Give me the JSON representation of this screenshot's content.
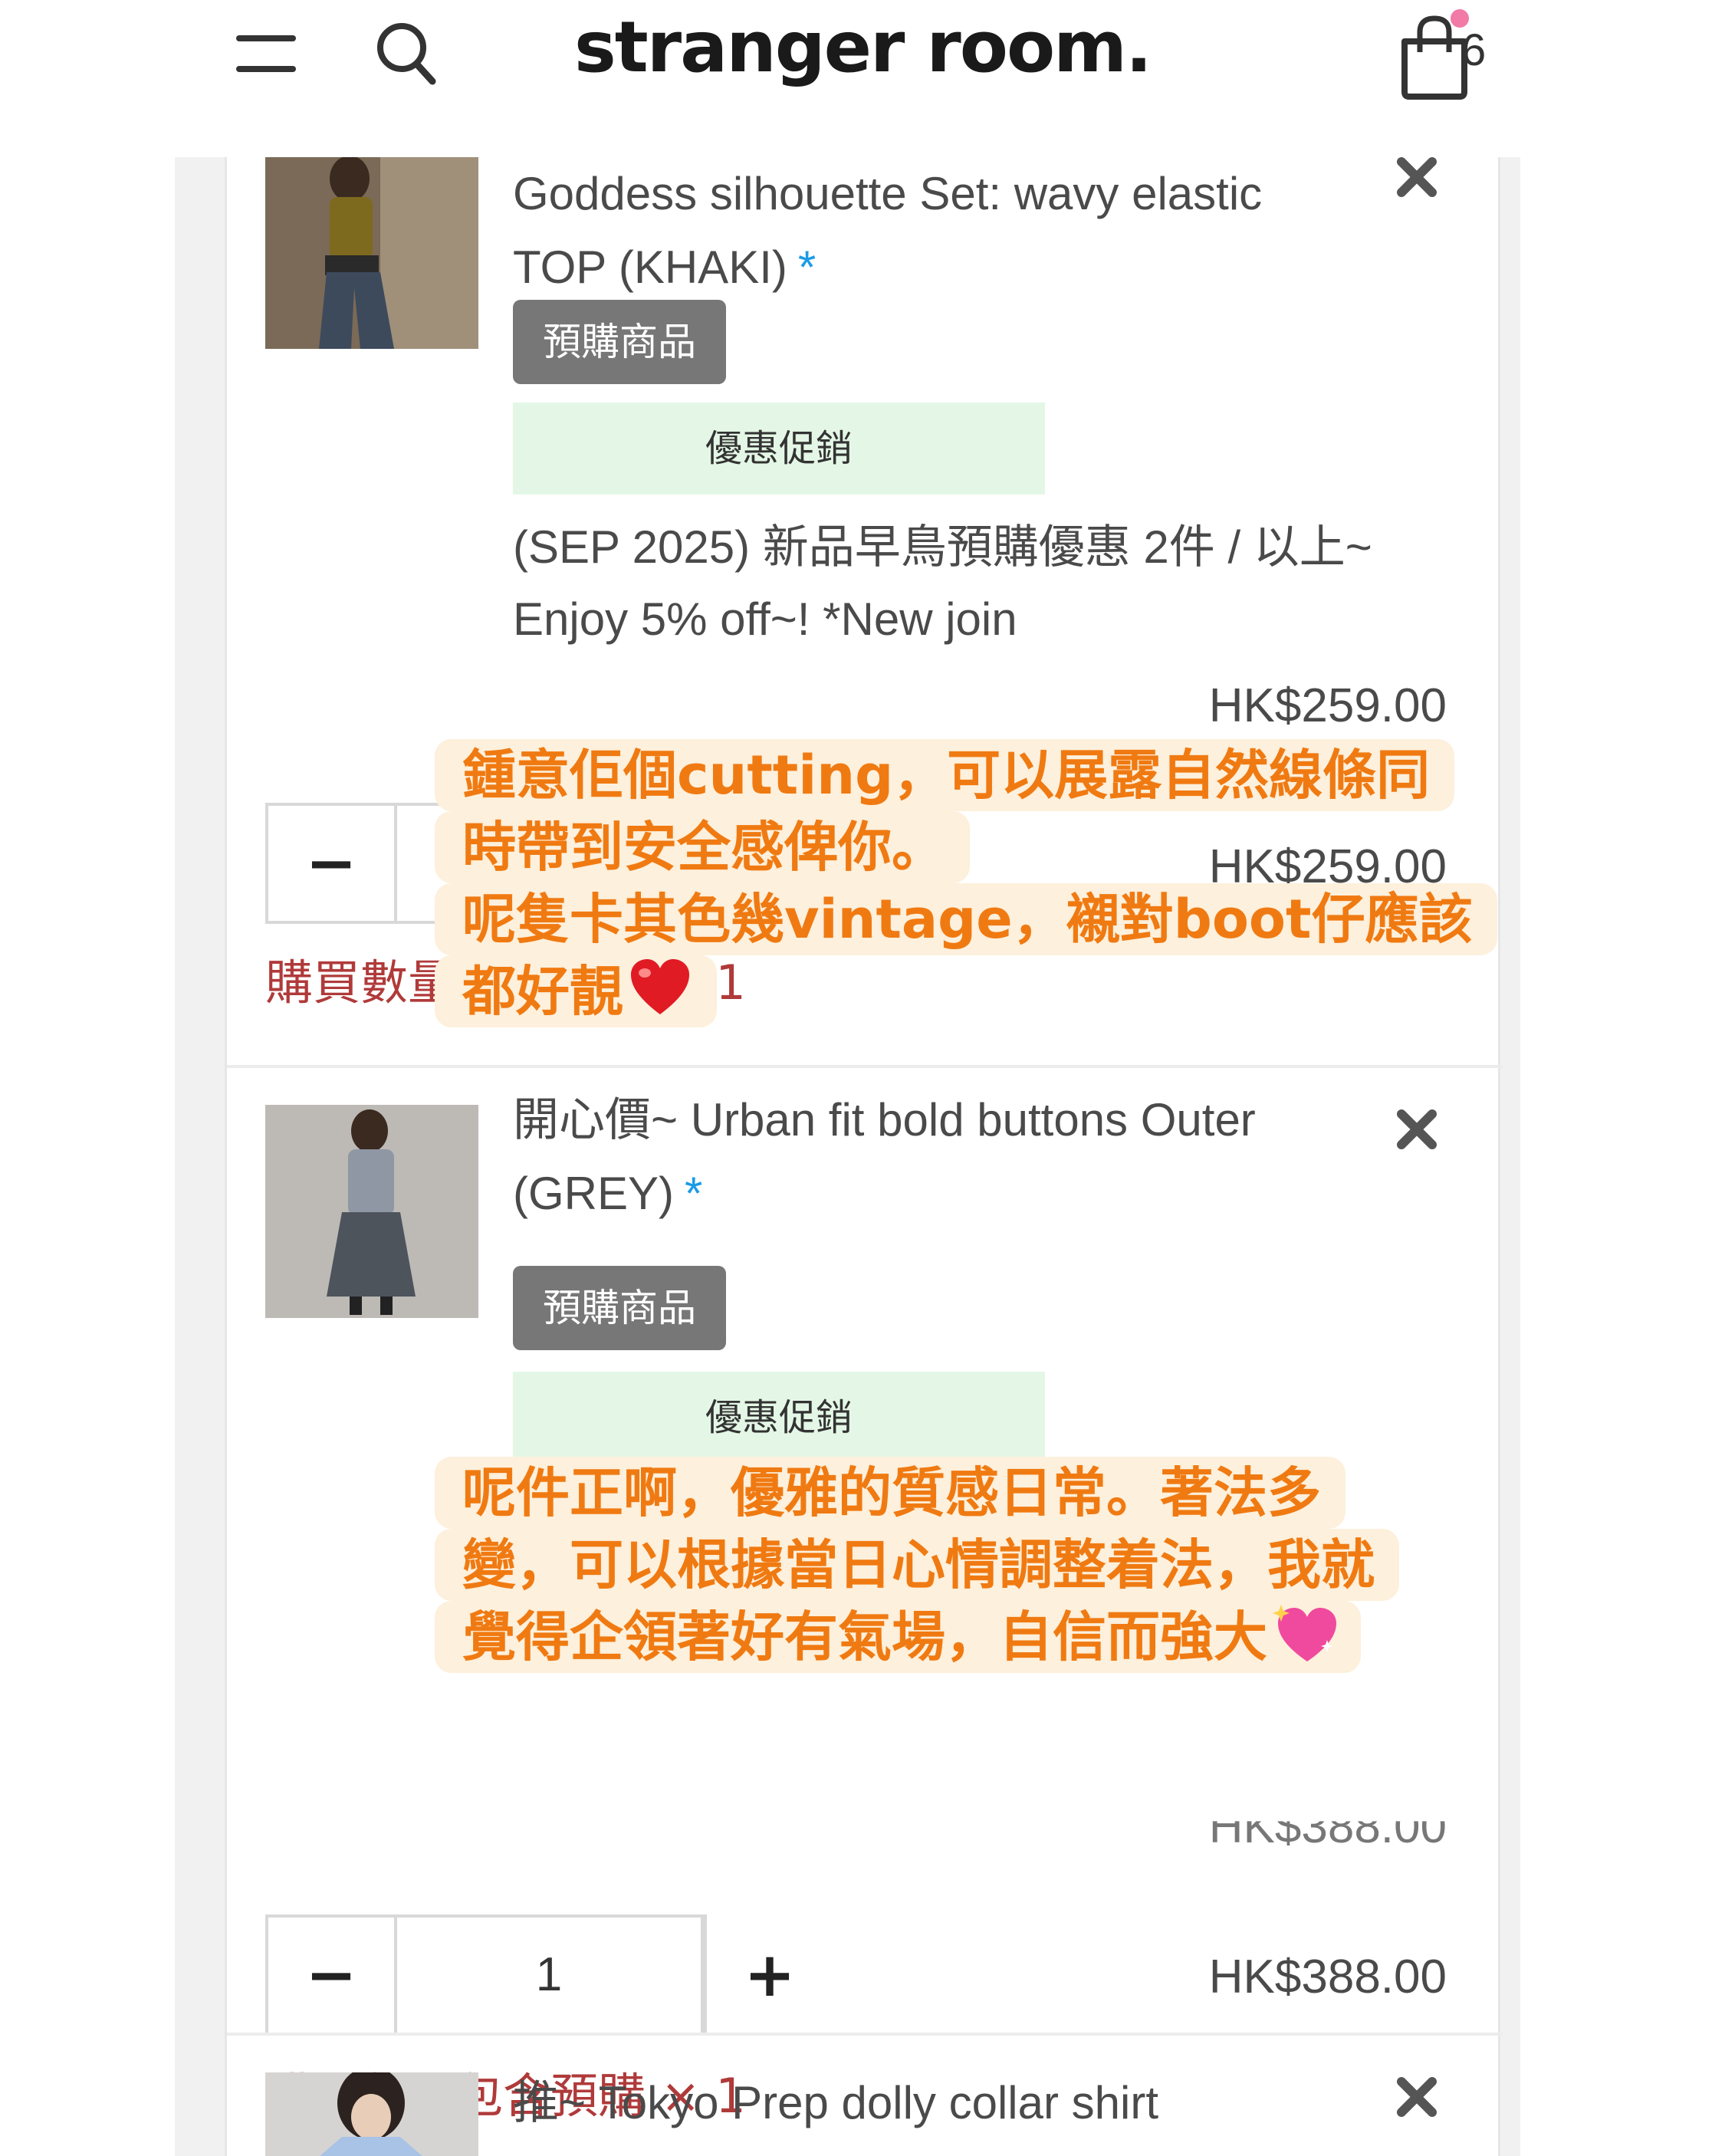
{
  "header": {
    "logo": "stranger room.",
    "cart_count": "6"
  },
  "items": [
    {
      "title_line1": "Goddess silhouette Set: wavy elastic",
      "title_line2": "TOP (KHAKI)",
      "asterisk": "*",
      "badge": "預購商品",
      "promo_box": "優惠促銷",
      "promo_line1": "(SEP 2025) 新品早鳥預購優惠 2件 / 以上~",
      "promo_line2": "Enjoy 5% off~! *New join",
      "unit_price": "HK$259.00",
      "subtotal": "HK$259.00",
      "quantity": "1",
      "preorder_note": "購買數量包含預購 × 1"
    },
    {
      "title_line1": "開心價~ Urban fit bold buttons Outer",
      "title_line2": "(GREY)",
      "asterisk": "*",
      "badge": "預購商品",
      "promo_box": "優惠促銷",
      "unit_price": "HK$388.00",
      "subtotal": "HK$388.00",
      "quantity": "1",
      "preorder_note": "購買數量包含預購 × 1"
    },
    {
      "title_line1": "推~ Tokyo Prep dolly collar shirt"
    }
  ],
  "overlay_notes": [
    {
      "lines": [
        "鍾意佢個cutting，可以展露自然線條同",
        "時帶到安全感俾你。",
        "呢隻卡其色幾vintage，襯對boot仔應該",
        "都好靚"
      ],
      "emoji": "red-heart"
    },
    {
      "lines": [
        "呢件正啊，優雅的質感日常。著法多",
        "變，可以根據當日心情調整着法，我就",
        "覺得企領著好有氣場，自信而強大"
      ],
      "emoji": "sparkling-heart"
    }
  ],
  "colors": {
    "note_text": "#f07a12",
    "note_bg": "#fdf0dc",
    "badge_bg": "#777777",
    "promo_bg": "#e4f7e6",
    "asterisk": "#1a9be6",
    "preorder_note": "#b03a3a",
    "cart_dot": "#f17aa6"
  }
}
